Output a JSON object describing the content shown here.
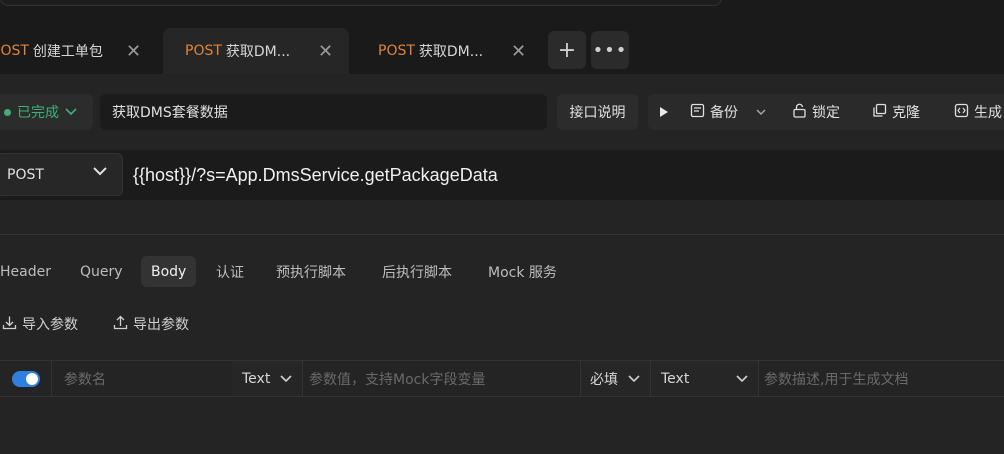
{
  "tabs": [
    {
      "method": "POST",
      "name": "创建工单包"
    },
    {
      "method": "POST",
      "name": "获取DM..."
    },
    {
      "method": "POST",
      "name": "获取DM..."
    }
  ],
  "toolbar": {
    "status": "已完成",
    "title": "获取DMS套餐数据",
    "doc_label": "接口说明",
    "backup_label": "备份",
    "lock_label": "锁定",
    "clone_label": "克隆",
    "generate_label": "生成"
  },
  "request": {
    "method": "POST",
    "url": "{{host}}/?s=App.DmsService.getPackageData"
  },
  "subtabs": [
    "Header",
    "Query",
    "Body",
    "认证",
    "预执行脚本",
    "后执行脚本",
    "Mock 服务"
  ],
  "body_actions": {
    "import": "导入参数",
    "export": "导出参数"
  },
  "param_row": {
    "name_placeholder": "参数名",
    "type": "Text",
    "value_placeholder": "参数值，支持Mock字段变量",
    "required": "必填",
    "content_type": "Text",
    "desc_placeholder": "参数描述,用于生成文档"
  },
  "colors": {
    "accent_orange": "#e0833a",
    "status_green": "#3fb07a",
    "toggle_blue": "#2f7fe0"
  }
}
